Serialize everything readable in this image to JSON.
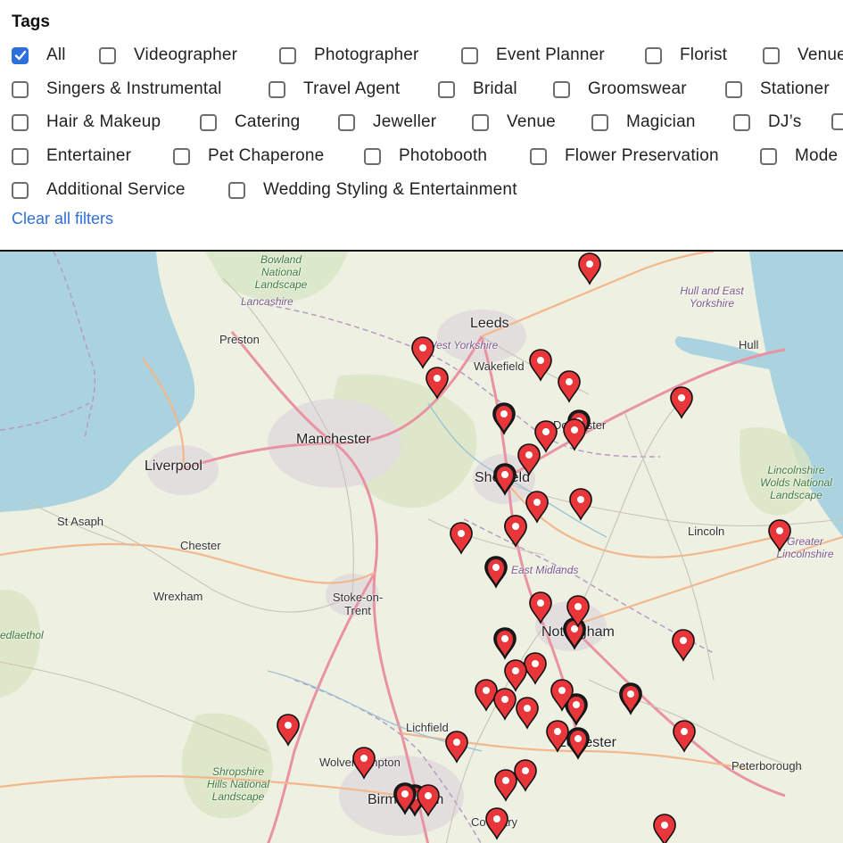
{
  "filters": {
    "title": "Tags",
    "clear_label": "Clear all filters",
    "tags": [
      {
        "label": "All",
        "checked": true
      },
      {
        "label": "Videographer",
        "checked": false
      },
      {
        "label": "Photographer",
        "checked": false
      },
      {
        "label": "Event Planner",
        "checked": false
      },
      {
        "label": "Florist",
        "checked": false
      },
      {
        "label": "Venue",
        "checked": false
      },
      {
        "label": "Singers & Instrumental",
        "checked": false
      },
      {
        "label": "Travel Agent",
        "checked": false
      },
      {
        "label": "Bridal",
        "checked": false
      },
      {
        "label": "Groomswear",
        "checked": false
      },
      {
        "label": "Stationer",
        "checked": false
      },
      {
        "label": "Hair & Makeup",
        "checked": false
      },
      {
        "label": "Catering",
        "checked": false
      },
      {
        "label": "Jeweller",
        "checked": false
      },
      {
        "label": "Venue",
        "checked": false
      },
      {
        "label": "Magician",
        "checked": false
      },
      {
        "label": "DJ’s",
        "checked": false
      },
      {
        "label": "Entertainer",
        "checked": false
      },
      {
        "label": "Pet Chaperone",
        "checked": false
      },
      {
        "label": "Photobooth",
        "checked": false
      },
      {
        "label": "Flower Preservation",
        "checked": false
      },
      {
        "label": "Mode",
        "checked": false
      },
      {
        "label": "Additional Service",
        "checked": false
      },
      {
        "label": "Wedding Styling & Entertainment",
        "checked": false
      }
    ]
  },
  "map": {
    "colors": {
      "sea": "#aad3df",
      "land": "#eef0e2",
      "pin_red": "#e8363b",
      "pin_dark": "#1e1e1e"
    },
    "places": {
      "leeds": "Leeds",
      "manchester": "Manchester",
      "liverpool": "Liverpool",
      "preston": "Preston",
      "wakefield": "Wakefield",
      "sheffield": "Sheffield",
      "hull": "Hull",
      "lincoln": "Lincoln",
      "chester": "Chester",
      "wrexham": "Wrexham",
      "st_asaph": "St Asaph",
      "stoke": "Stoke-on-Trent",
      "lichfield": "Lichfield",
      "wolverhampton": "Wolverhampton",
      "birmingham": "Birmingham",
      "coventry": "Coventry",
      "peterborough": "Peterborough",
      "nottingham": "Nottingham",
      "leicester": "Leicester",
      "doncaster": "Doncaster",
      "lancashire": "Lancashire",
      "west_yorkshire": "West Yorkshire",
      "hull_east_yorkshire": "Hull and East Yorkshire",
      "east_midlands": "East Midlands",
      "greater_lincolnshire": "Greater Lincolnshire",
      "bowland": "Bowland National Landscape",
      "lincolnshire_wolds": "Lincolnshire Wolds National Landscape",
      "shropshire_hills": "Shropshire Hills National Landscape",
      "welsh_fragment": "edlaethol"
    },
    "pin_icon": "map-marker-icon"
  }
}
